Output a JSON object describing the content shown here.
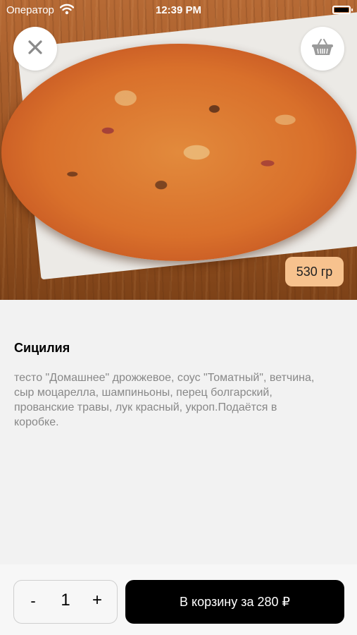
{
  "status_bar": {
    "carrier": "Оператор",
    "time": "12:39 PM"
  },
  "hero": {
    "weight": "530 гр"
  },
  "product": {
    "title": "Сицилия",
    "description": "тесто \"Домашнее\" дрожжевое, соус \"Томатный\", ветчина, сыр моцарелла, шампиньоны, перец болгарский, прованские травы, лук красный, укроп.Подаётся в коробке."
  },
  "stepper": {
    "minus": "-",
    "quantity": "1",
    "plus": "+"
  },
  "add_to_cart_label": "В корзину за 280 ₽",
  "icons": {
    "close": "close-icon",
    "cart": "basket-icon",
    "wifi": "wifi-icon",
    "battery": "battery-icon"
  },
  "colors": {
    "badge": "#f7c28e",
    "primary_button": "#000000",
    "background": "#f2f2f2"
  }
}
